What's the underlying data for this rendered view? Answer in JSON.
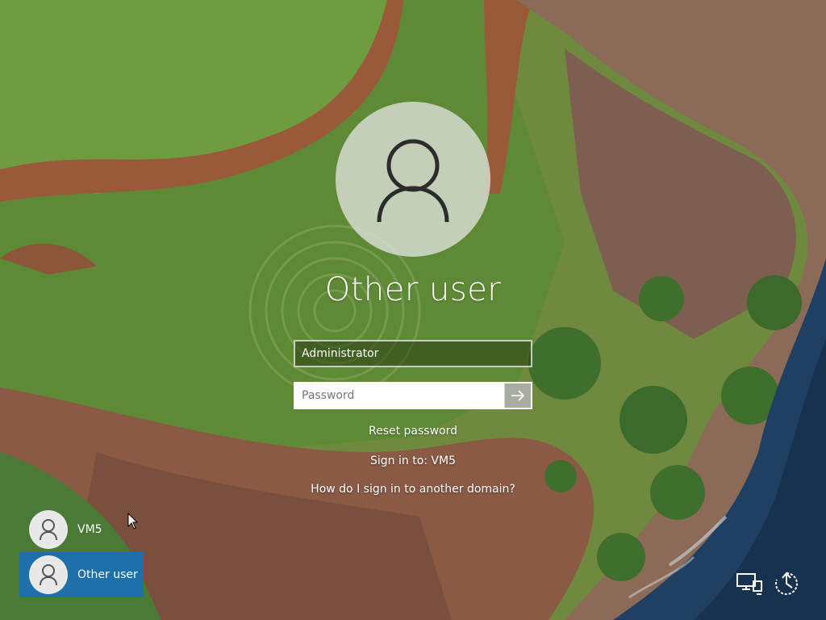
{
  "login": {
    "user_display_name": "Other user",
    "username_value": "Administrator",
    "password_placeholder": "Password",
    "reset_password": "Reset password",
    "sign_in_to": "Sign in to: VM5",
    "domain_help": "How do I sign in to another domain?"
  },
  "user_list": [
    {
      "name": "VM5",
      "selected": false
    },
    {
      "name": "Other user",
      "selected": true
    }
  ],
  "icons": {
    "network": "network-icon",
    "ease_of_access": "ease-of-access-icon",
    "submit": "arrow-right-icon",
    "user": "user-icon"
  },
  "colors": {
    "selected_tile": "#1f6fa8"
  }
}
